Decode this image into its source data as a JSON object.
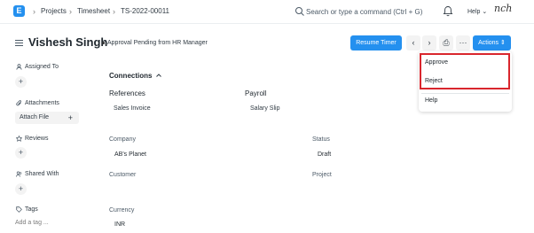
{
  "navbar": {
    "logo_letter": "E",
    "breadcrumbs": [
      "Projects",
      "Timesheet",
      "TS-2022-00011"
    ],
    "search_placeholder": "Search or type a command (Ctrl + G)",
    "help_label": "Help",
    "avatar_text": "nch"
  },
  "page": {
    "title": "Vishesh Singh",
    "status": "Approval Pending from HR Manager",
    "resume_timer_label": "Resume Timer",
    "prev_icon": "‹",
    "next_icon": "›",
    "print_icon": "⎙",
    "more_icon": "···",
    "actions_label": "Actions"
  },
  "actions_menu": {
    "items": [
      "Approve",
      "Reject",
      "Help"
    ]
  },
  "sidebar": {
    "assigned_to": "Assigned To",
    "attachments": "Attachments",
    "attach_file": "Attach File",
    "reviews": "Reviews",
    "shared_with": "Shared With",
    "tags": "Tags",
    "add_tag": "Add a tag ..."
  },
  "connections": {
    "title": "Connections",
    "references_label": "References",
    "references_item": "Sales Invoice",
    "payroll_label": "Payroll",
    "payroll_item": "Salary Slip"
  },
  "fields": {
    "company_label": "Company",
    "company_value": "AB's Planet",
    "status_label": "Status",
    "status_value": "Draft",
    "customer_label": "Customer",
    "project_label": "Project",
    "currency_label": "Currency",
    "currency_value": "INR"
  },
  "colors": {
    "primary": "#2490ef",
    "highlight_border": "#d9262d"
  }
}
